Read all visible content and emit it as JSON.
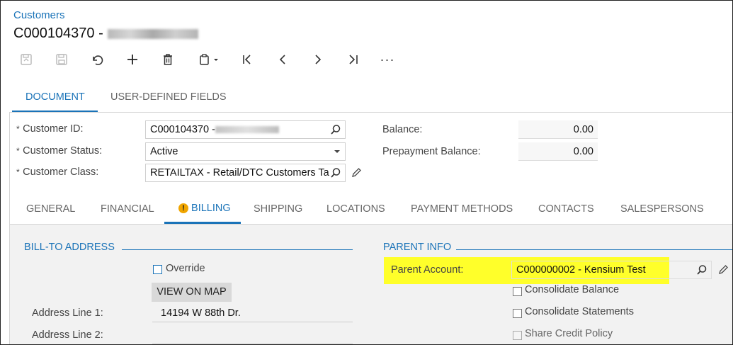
{
  "breadcrumb": "Customers",
  "title": {
    "id": "C000104370 -"
  },
  "toolbar": {
    "icons": [
      "cancel-changes-icon",
      "save-icon",
      "undo-icon",
      "add-icon",
      "delete-icon",
      "copy-paste-icon",
      "first-record-icon",
      "previous-record-icon",
      "next-record-icon",
      "last-record-icon",
      "more-icon"
    ],
    "more": "···"
  },
  "tabs": [
    {
      "label": "DOCUMENT",
      "active": true
    },
    {
      "label": "USER-DEFINED FIELDS",
      "active": false
    }
  ],
  "form": {
    "customer_id": {
      "label": "Customer ID:",
      "value": "C000104370 -"
    },
    "customer_status": {
      "label": "Customer Status:",
      "value": "Active"
    },
    "customer_class": {
      "label": "Customer Class:",
      "value": "RETAILTAX - Retail/DTC Customers Ta"
    },
    "balance": {
      "label": "Balance:",
      "value": "0.00"
    },
    "prepayment_balance": {
      "label": "Prepayment Balance:",
      "value": "0.00"
    },
    "required_mark": "*"
  },
  "subtabs": [
    {
      "label": "GENERAL"
    },
    {
      "label": "FINANCIAL"
    },
    {
      "label": "BILLING",
      "active": true,
      "warning": "!"
    },
    {
      "label": "SHIPPING"
    },
    {
      "label": "LOCATIONS"
    },
    {
      "label": "PAYMENT METHODS"
    },
    {
      "label": "CONTACTS"
    },
    {
      "label": "SALESPERSONS"
    }
  ],
  "billing": {
    "bill_to_header": "BILL-TO ADDRESS",
    "override_label": "Override",
    "view_on_map": "VIEW ON MAP",
    "address_line1_label": "Address Line 1:",
    "address_line1_value": "14194 W 88th Dr.",
    "address_line2_label": "Address Line 2:",
    "parent_info_header": "PARENT INFO",
    "parent_account_label": "Parent Account:",
    "parent_account_value": "C000000002 - Kensium Test",
    "consolidate_balance": "Consolidate Balance",
    "consolidate_statements": "Consolidate Statements",
    "share_credit_policy": "Share Credit Policy"
  },
  "colors": {
    "accent": "#1a73b8",
    "highlight": "#ffff2a"
  }
}
